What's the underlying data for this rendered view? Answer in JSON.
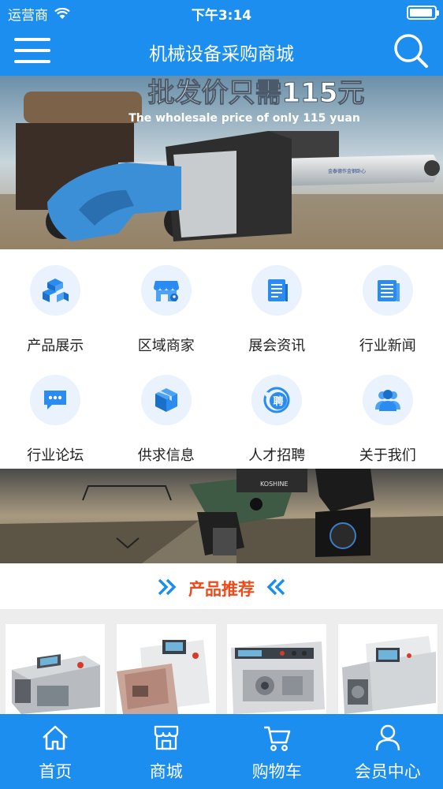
{
  "status_bar": {
    "carrier": "运营商",
    "time": "下午3:14"
  },
  "header": {
    "title": "机械设备采购商城"
  },
  "banner": {
    "headline": "批发价只需115元",
    "subline": "The wholesale price of only 115 yuan",
    "brand_text": "金泰德作金钢卧心"
  },
  "categories": [
    {
      "label": "产品展示",
      "icon": "boxes-icon"
    },
    {
      "label": "区域商家",
      "icon": "shop-icon"
    },
    {
      "label": "展会资讯",
      "icon": "document-icon"
    },
    {
      "label": "行业新闻",
      "icon": "newspaper-icon"
    },
    {
      "label": "行业论坛",
      "icon": "chat-icon"
    },
    {
      "label": "供求信息",
      "icon": "package-icon"
    },
    {
      "label": "人才招聘",
      "icon": "hire-icon"
    },
    {
      "label": "关于我们",
      "icon": "people-icon"
    }
  ],
  "banner2": {
    "label_text": "KOSHINE"
  },
  "recommend": {
    "title": "产品推荐"
  },
  "tabs": [
    {
      "label": "首页",
      "icon": "home-icon"
    },
    {
      "label": "商城",
      "icon": "store-icon"
    },
    {
      "label": "购物车",
      "icon": "cart-icon"
    },
    {
      "label": "会员中心",
      "icon": "user-icon"
    }
  ],
  "colors": {
    "primary": "#1b8ef0",
    "accent": "#f04a1a",
    "icon_bg": "#e9f2fd",
    "icon_blue": "#2a8cf0"
  }
}
